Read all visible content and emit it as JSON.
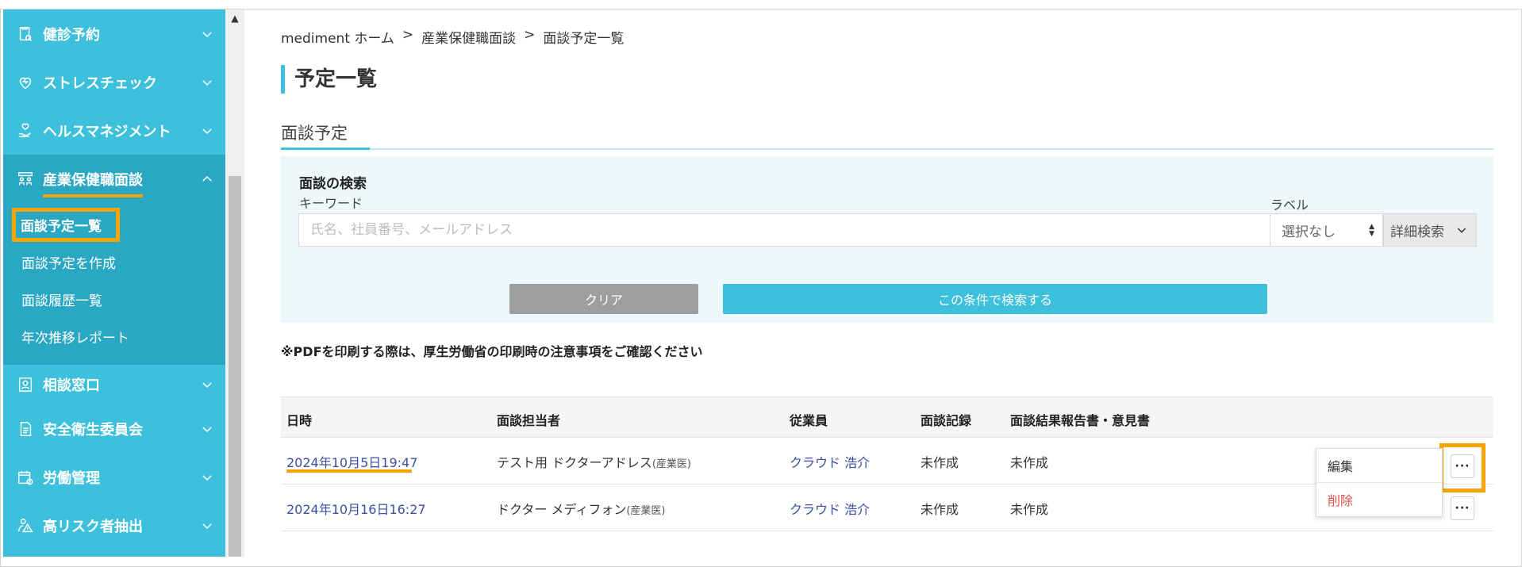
{
  "sidebar": {
    "items": [
      {
        "label": "健診予約",
        "icon": "checkup-icon"
      },
      {
        "label": "ストレスチェック",
        "icon": "heart-icon"
      },
      {
        "label": "ヘルスマネジメント",
        "icon": "health-hand-icon"
      },
      {
        "label": "産業保健職面談",
        "icon": "interview-icon"
      },
      {
        "label": "相談窓口",
        "icon": "consult-icon"
      },
      {
        "label": "安全衛生委員会",
        "icon": "document-icon"
      },
      {
        "label": "労働管理",
        "icon": "calendar-icon"
      },
      {
        "label": "高リスク者抽出",
        "icon": "risk-person-icon"
      }
    ],
    "submenu": [
      "面談予定一覧",
      "面談予定を作成",
      "面談履歴一覧",
      "年次推移レポート"
    ]
  },
  "breadcrumb": [
    "mediment ホーム",
    ">",
    "産業保健職面談",
    ">",
    "面談予定一覧"
  ],
  "page_title": "予定一覧",
  "section_tab": "面談予定",
  "search": {
    "title": "面談の検索",
    "keyword_label": "キーワード",
    "keyword_placeholder": "氏名、社員番号、メールアドレス",
    "label_title": "ラベル",
    "label_value": "選択なし",
    "detail_label": "詳細検索",
    "clear_label": "クリア",
    "submit_label": "この条件で検索する"
  },
  "pdf_note": "※PDFを印刷する際は、厚生労働省の印刷時の注意事項をご確認ください",
  "table": {
    "headers": [
      "日時",
      "面談担当者",
      "従業員",
      "面談記録",
      "面談結果報告書・意見書"
    ],
    "rows": [
      {
        "date": "2024年10月5日19:47",
        "staff": "テスト用 ドクターアドレス",
        "role": "(産業医)",
        "employee": "クラウド 浩介",
        "record": "未作成",
        "report": "未作成"
      },
      {
        "date": "2024年10月16日16:27",
        "staff": "ドクター メディフォン",
        "role": "(産業医)",
        "employee": "クラウド 浩介",
        "record": "未作成",
        "report": "未作成"
      }
    ],
    "more_label": "···"
  },
  "dropdown": {
    "edit": "編集",
    "delete": "削除"
  },
  "colors": {
    "accent": "#3cc0db",
    "highlight": "#f6a500",
    "link": "#3a4fa0",
    "danger": "#e0504a"
  }
}
